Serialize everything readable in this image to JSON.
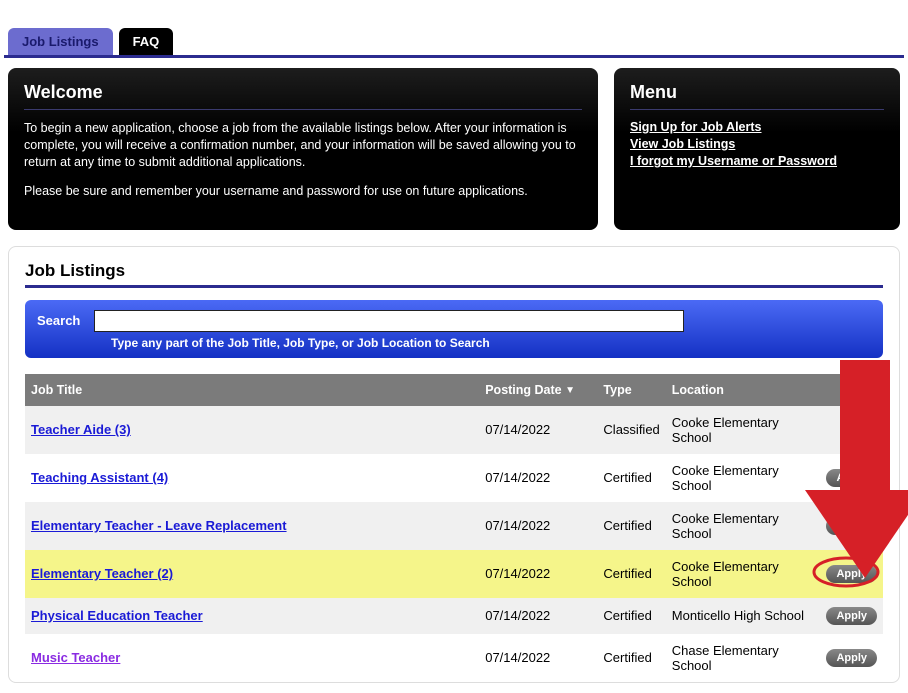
{
  "tabs": [
    {
      "label": "Job Listings",
      "active": true
    },
    {
      "label": "FAQ",
      "active": false
    }
  ],
  "welcome": {
    "title": "Welcome",
    "para1": "To begin a new application, choose a job from the available listings below. After your information is complete, you will receive a confirmation number, and your information will be saved allowing you to return at any time to submit additional applications.",
    "para2": "Please be sure and remember your username and password for use on future applications."
  },
  "menu": {
    "title": "Menu",
    "links": [
      "Sign Up for Job Alerts",
      "View Job Listings",
      "I forgot my Username or Password"
    ]
  },
  "listings": {
    "heading": "Job Listings",
    "search_label": "Search",
    "search_hint": "Type any part of the Job Title, Job Type, or Job Location to Search",
    "columns": {
      "title": "Job Title",
      "date": "Posting Date",
      "type": "Type",
      "location": "Location"
    },
    "apply_label": "Apply",
    "rows": [
      {
        "title": "Teacher Aide (3)",
        "date": "07/14/2022",
        "type": "Classified",
        "location": "Cooke Elementary School",
        "apply": false,
        "highlight": false,
        "visited": false
      },
      {
        "title": "Teaching Assistant (4)",
        "date": "07/14/2022",
        "type": "Certified",
        "location": "Cooke Elementary School",
        "apply": true,
        "highlight": false,
        "visited": false
      },
      {
        "title": "Elementary Teacher - Leave Replacement",
        "date": "07/14/2022",
        "type": "Certified",
        "location": "Cooke Elementary School",
        "apply": true,
        "highlight": false,
        "visited": false
      },
      {
        "title": "Elementary Teacher (2)",
        "date": "07/14/2022",
        "type": "Certified",
        "location": "Cooke Elementary School",
        "apply": true,
        "highlight": true,
        "visited": false
      },
      {
        "title": "Physical Education Teacher",
        "date": "07/14/2022",
        "type": "Certified",
        "location": "Monticello High School",
        "apply": true,
        "highlight": false,
        "visited": false
      },
      {
        "title": "Music Teacher",
        "date": "07/14/2022",
        "type": "Certified",
        "location": "Chase Elementary School",
        "apply": true,
        "highlight": false,
        "visited": true
      }
    ]
  },
  "annotation": {
    "arrow_color": "#d62027",
    "circle_color": "#d62027",
    "circle_row_index": 3
  }
}
